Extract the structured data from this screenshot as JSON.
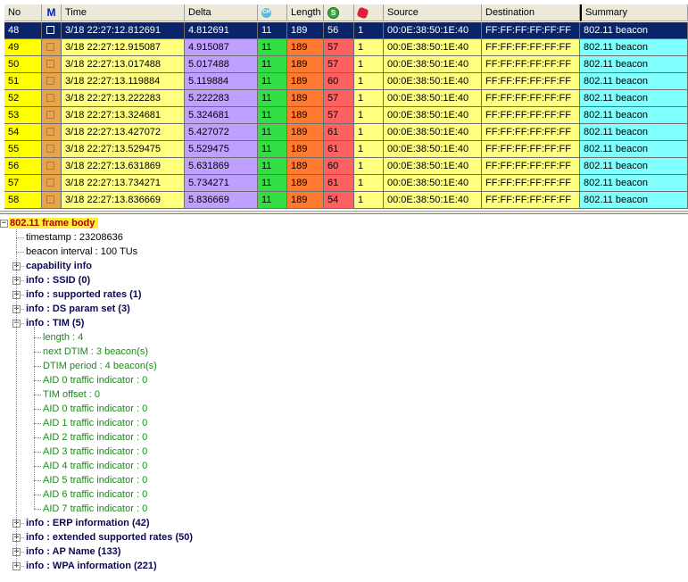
{
  "columns": {
    "no": "No",
    "mark": "M",
    "time": "Time",
    "delta": "Delta",
    "channel_icon": "CH",
    "length": "Length",
    "signal_icon": "S",
    "flag_icon": "",
    "source": "Source",
    "destination": "Destination",
    "summary": "Summary"
  },
  "colors": {
    "no": "#ffff00",
    "mark": "#e8a44a",
    "time": "#ffff80",
    "delta": "#c0a0ff",
    "ch": "#33dd44",
    "length": "#ff7a30",
    "signal": "#ff6060",
    "flag": "#ffff80",
    "source": "#ffff80",
    "destination": "#ffff80",
    "summary": "#80ffff",
    "selected": "#0a246a"
  },
  "rows": [
    {
      "no": "48",
      "time": "3/18 22:27:12.812691",
      "delta": "4.812691",
      "ch": "11",
      "length": "189",
      "signal": "56",
      "flag": "1",
      "source": "00:0E:38:50:1E:40",
      "destination": "FF:FF:FF:FF:FF:FF",
      "summary": "802.11 beacon",
      "selected": true
    },
    {
      "no": "49",
      "time": "3/18 22:27:12.915087",
      "delta": "4.915087",
      "ch": "11",
      "length": "189",
      "signal": "57",
      "flag": "1",
      "source": "00:0E:38:50:1E:40",
      "destination": "FF:FF:FF:FF:FF:FF",
      "summary": "802.11 beacon"
    },
    {
      "no": "50",
      "time": "3/18 22:27:13.017488",
      "delta": "5.017488",
      "ch": "11",
      "length": "189",
      "signal": "57",
      "flag": "1",
      "source": "00:0E:38:50:1E:40",
      "destination": "FF:FF:FF:FF:FF:FF",
      "summary": "802.11 beacon"
    },
    {
      "no": "51",
      "time": "3/18 22:27:13.119884",
      "delta": "5.119884",
      "ch": "11",
      "length": "189",
      "signal": "60",
      "flag": "1",
      "source": "00:0E:38:50:1E:40",
      "destination": "FF:FF:FF:FF:FF:FF",
      "summary": "802.11 beacon"
    },
    {
      "no": "52",
      "time": "3/18 22:27:13.222283",
      "delta": "5.222283",
      "ch": "11",
      "length": "189",
      "signal": "57",
      "flag": "1",
      "source": "00:0E:38:50:1E:40",
      "destination": "FF:FF:FF:FF:FF:FF",
      "summary": "802.11 beacon"
    },
    {
      "no": "53",
      "time": "3/18 22:27:13.324681",
      "delta": "5.324681",
      "ch": "11",
      "length": "189",
      "signal": "57",
      "flag": "1",
      "source": "00:0E:38:50:1E:40",
      "destination": "FF:FF:FF:FF:FF:FF",
      "summary": "802.11 beacon"
    },
    {
      "no": "54",
      "time": "3/18 22:27:13.427072",
      "delta": "5.427072",
      "ch": "11",
      "length": "189",
      "signal": "61",
      "flag": "1",
      "source": "00:0E:38:50:1E:40",
      "destination": "FF:FF:FF:FF:FF:FF",
      "summary": "802.11 beacon"
    },
    {
      "no": "55",
      "time": "3/18 22:27:13.529475",
      "delta": "5.529475",
      "ch": "11",
      "length": "189",
      "signal": "61",
      "flag": "1",
      "source": "00:0E:38:50:1E:40",
      "destination": "FF:FF:FF:FF:FF:FF",
      "summary": "802.11 beacon"
    },
    {
      "no": "56",
      "time": "3/18 22:27:13.631869",
      "delta": "5.631869",
      "ch": "11",
      "length": "189",
      "signal": "60",
      "flag": "1",
      "source": "00:0E:38:50:1E:40",
      "destination": "FF:FF:FF:FF:FF:FF",
      "summary": "802.11 beacon"
    },
    {
      "no": "57",
      "time": "3/18 22:27:13.734271",
      "delta": "5.734271",
      "ch": "11",
      "length": "189",
      "signal": "61",
      "flag": "1",
      "source": "00:0E:38:50:1E:40",
      "destination": "FF:FF:FF:FF:FF:FF",
      "summary": "802.11 beacon"
    },
    {
      "no": "58",
      "time": "3/18 22:27:13.836669",
      "delta": "5.836669",
      "ch": "11",
      "length": "189",
      "signal": "54",
      "flag": "1",
      "source": "00:0E:38:50:1E:40",
      "destination": "FF:FF:FF:FF:FF:FF",
      "summary": "802.11 beacon"
    }
  ],
  "tree": {
    "root": "802.11 frame body",
    "items": [
      {
        "text": "timestamp : 23208636",
        "style": "plain",
        "level": 1
      },
      {
        "text": "beacon interval : 100 TUs",
        "style": "plain",
        "level": 1
      },
      {
        "text": "capability info",
        "style": "bold",
        "level": 1,
        "expander": "plus"
      },
      {
        "text": "info : SSID (0)",
        "style": "bold",
        "level": 1,
        "expander": "plus"
      },
      {
        "text": "info : supported rates (1)",
        "style": "bold",
        "level": 1,
        "expander": "plus"
      },
      {
        "text": "info : DS param set (3)",
        "style": "bold",
        "level": 1,
        "expander": "plus"
      },
      {
        "text": "info : TIM (5)",
        "style": "bold",
        "level": 1,
        "expander": "minus"
      },
      {
        "text": "length : 4",
        "style": "green",
        "level": 2
      },
      {
        "text": "next DTIM : 3 beacon(s)",
        "style": "green",
        "level": 2
      },
      {
        "text": "DTIM period : 4 beacon(s)",
        "style": "green",
        "level": 2
      },
      {
        "text": "AID 0 traffic indicator : 0",
        "style": "green",
        "level": 2
      },
      {
        "text": "TIM offset : 0",
        "style": "green",
        "level": 2
      },
      {
        "text": "AID 0 traffic indicator : 0",
        "style": "green",
        "level": 2
      },
      {
        "text": "AID 1 traffic indicator : 0",
        "style": "green",
        "level": 2
      },
      {
        "text": "AID 2 traffic indicator : 0",
        "style": "green",
        "level": 2
      },
      {
        "text": "AID 3 traffic indicator : 0",
        "style": "green",
        "level": 2
      },
      {
        "text": "AID 4 traffic indicator : 0",
        "style": "green",
        "level": 2
      },
      {
        "text": "AID 5 traffic indicator : 0",
        "style": "green",
        "level": 2
      },
      {
        "text": "AID 6 traffic indicator : 0",
        "style": "green",
        "level": 2
      },
      {
        "text": "AID 7 traffic indicator : 0",
        "style": "green",
        "level": 2
      },
      {
        "text": "info : ERP information (42)",
        "style": "bold",
        "level": 1,
        "expander": "plus"
      },
      {
        "text": "info : extended supported rates (50)",
        "style": "bold",
        "level": 1,
        "expander": "plus"
      },
      {
        "text": "info : AP Name (133)",
        "style": "bold",
        "level": 1,
        "expander": "plus"
      },
      {
        "text": "info : WPA information (221)",
        "style": "bold",
        "level": 1,
        "expander": "plus"
      }
    ]
  }
}
